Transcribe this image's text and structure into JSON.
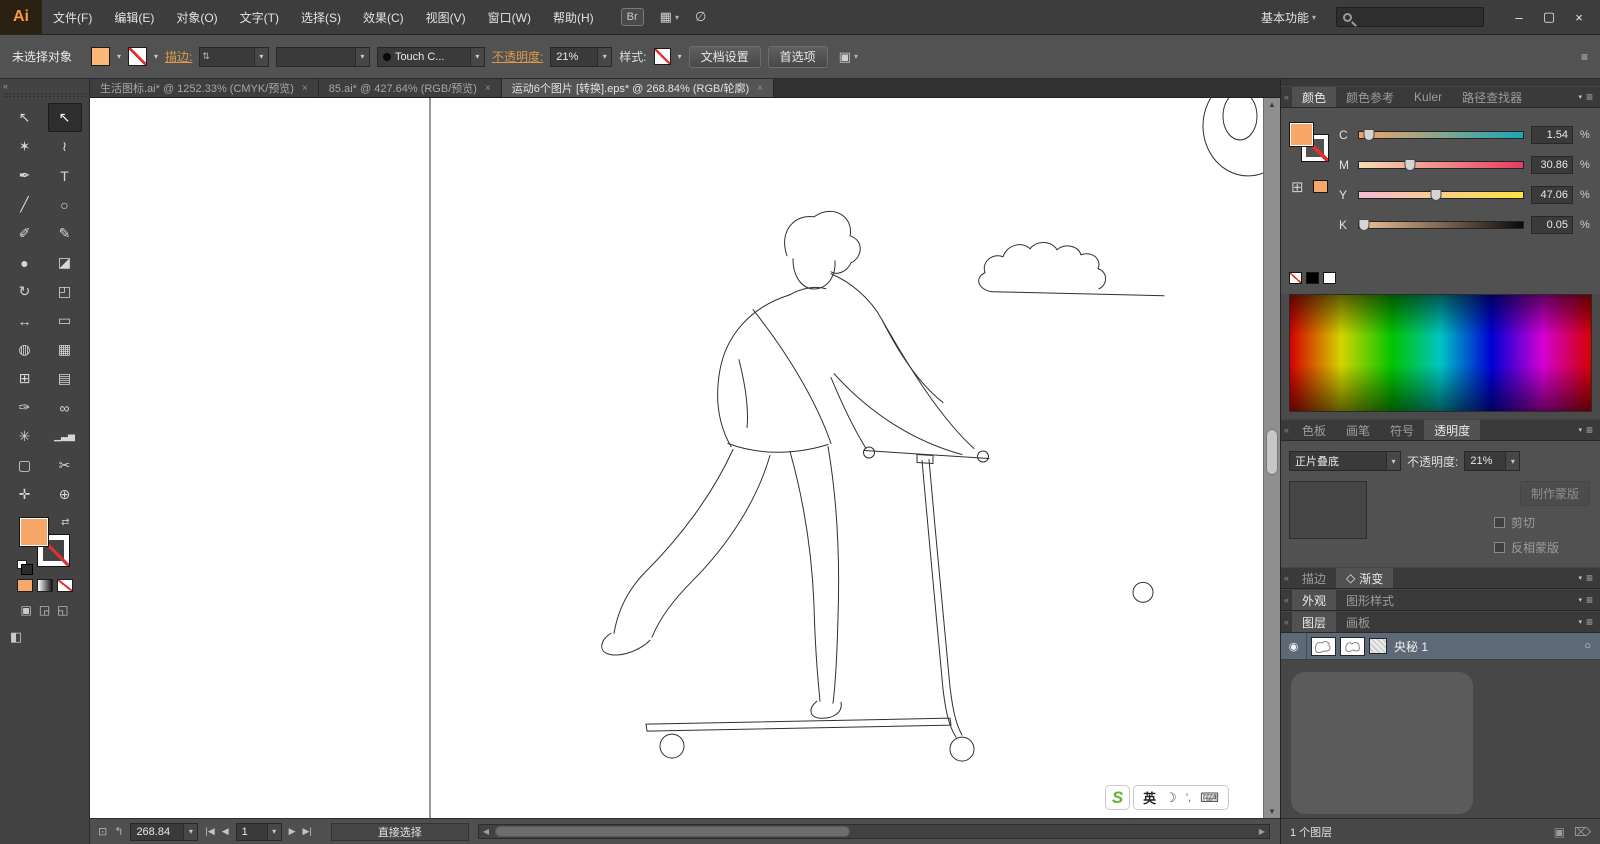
{
  "colors": {
    "accent_orange": "#f7a868",
    "controlbar_swatch": "#fbb878",
    "link_orange": "#d79b4a",
    "layer_selected_row": "#5e6977"
  },
  "glyphs": {
    "dd": "▾",
    "up": "▲",
    "down": "▼",
    "left": "◀",
    "right": "▶",
    "first": "|◀",
    "last": "▶|",
    "close_tab": "×",
    "minimize": "–",
    "restore": "▢",
    "close": "×",
    "menu": "≡",
    "collapse": "«",
    "eye": "◉",
    "target": "○",
    "diamond": "◇",
    "swap": "⇄",
    "stepper": "⇅",
    "arrange": "▦",
    "slashed": "∅",
    "moon": "☽",
    "keyboard": "⌨",
    "marks": "’,",
    "status1": "⊡",
    "status2": "↰",
    "mode1": "▣",
    "mode2": "◲",
    "mode3": "◱",
    "screen": "◧",
    "cube": "⊞",
    "newlayer": "▣",
    "trash": "⌦"
  },
  "titlebar": {
    "app": "Ai",
    "menus": [
      "文件(F)",
      "编辑(E)",
      "对象(O)",
      "文字(T)",
      "选择(S)",
      "效果(C)",
      "视图(V)",
      "窗口(W)",
      "帮助(H)"
    ],
    "bridge": "Br",
    "workspace": "基本功能"
  },
  "controlbar": {
    "status": "未选择对象",
    "stroke_label": "描边:",
    "brush": "Touch C...",
    "opacity_label": "不透明度:",
    "opacity": "21%",
    "style_label": "样式:",
    "doc_setup": "文档设置",
    "prefs": "首选项"
  },
  "tabs": [
    {
      "title": "生活图标.ai* @ 1252.33% (CMYK/预览)"
    },
    {
      "title": "85.ai* @ 427.64% (RGB/预览)"
    },
    {
      "title": "运动6个图片 [转换].eps* @ 268.84% (RGB/轮廓)"
    }
  ],
  "tools": [
    {
      "id": "selection",
      "glyph": "↖"
    },
    {
      "id": "direct-selection",
      "glyph": "↖"
    },
    {
      "id": "magic-wand",
      "glyph": "✶"
    },
    {
      "id": "lasso",
      "glyph": "≀"
    },
    {
      "id": "pen",
      "glyph": "✒"
    },
    {
      "id": "type",
      "glyph": "T"
    },
    {
      "id": "line",
      "glyph": "╱"
    },
    {
      "id": "ellipse",
      "glyph": "○"
    },
    {
      "id": "paintbrush",
      "glyph": "✐"
    },
    {
      "id": "pencil",
      "glyph": "✎"
    },
    {
      "id": "blob-brush",
      "glyph": "●"
    },
    {
      "id": "eraser",
      "glyph": "◪"
    },
    {
      "id": "rotate",
      "glyph": "↻"
    },
    {
      "id": "scale",
      "glyph": "◰"
    },
    {
      "id": "width",
      "glyph": "↔"
    },
    {
      "id": "free-transform",
      "glyph": "▭"
    },
    {
      "id": "shape-builder",
      "glyph": "◍"
    },
    {
      "id": "perspective-grid",
      "glyph": "▦"
    },
    {
      "id": "mesh",
      "glyph": "⊞"
    },
    {
      "id": "gradient",
      "glyph": "▤"
    },
    {
      "id": "eyedropper",
      "glyph": "✑"
    },
    {
      "id": "blend",
      "glyph": "∞"
    },
    {
      "id": "symbol-sprayer",
      "glyph": "✳"
    },
    {
      "id": "column-graph",
      "glyph": "▁▃▅"
    },
    {
      "id": "artboard",
      "glyph": "▢"
    },
    {
      "id": "slice",
      "glyph": "✂"
    },
    {
      "id": "hand",
      "glyph": "✛"
    },
    {
      "id": "zoom",
      "glyph": "⊕"
    }
  ],
  "color_panel": {
    "tabs": [
      "颜色",
      "颜色参考",
      "Kuler",
      "路径查找器"
    ],
    "unit": "%",
    "sliders": [
      {
        "label": "C",
        "value": "1.54",
        "pos": 6
      },
      {
        "label": "M",
        "value": "30.86",
        "pos": 31
      },
      {
        "label": "Y",
        "value": "47.06",
        "pos": 47
      },
      {
        "label": "K",
        "value": "0.05",
        "pos": 3
      }
    ]
  },
  "mid_tabs": [
    "色板",
    "画笔",
    "符号",
    "透明度"
  ],
  "transparency": {
    "blend": "正片叠底",
    "opacity_label": "不透明度:",
    "opacity": "21%",
    "make_mask": "制作蒙版",
    "clip": "剪切",
    "invert": "反相蒙版"
  },
  "lower_tabs1": [
    "描边",
    "渐变"
  ],
  "lower_tabs2": [
    "外观",
    "图形样式"
  ],
  "layers": {
    "tabs": [
      "图层",
      "画板"
    ],
    "layer_name": "央秘 1",
    "count": "1 个图层"
  },
  "statusbar": {
    "zoom": "268.84",
    "page": "1",
    "tool": "直接选择"
  },
  "ime": {
    "logo": "S",
    "lang": "英"
  }
}
